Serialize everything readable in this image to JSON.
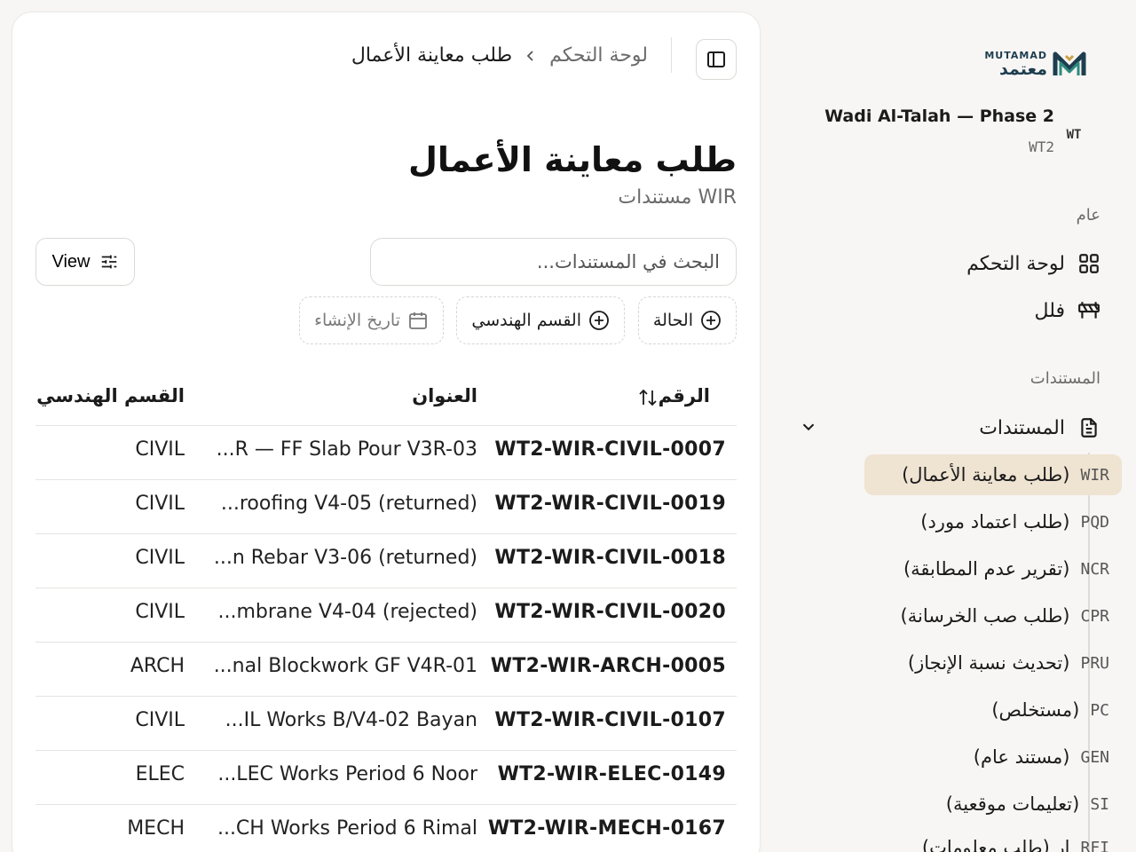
{
  "brand": {
    "name_en": "MUTAMAD",
    "name_ar": "معتمد",
    "colors": {
      "navy": "#1e3d4f",
      "teal": "#2f8a7e",
      "gold": "#c9a24a"
    }
  },
  "project": {
    "badge": "WT",
    "name": "Wadi Al-Talah — Phase 2",
    "code": "WT2"
  },
  "sidebar": {
    "section_general": "عام",
    "nav": [
      {
        "label": "لوحة التحكم",
        "icon": "dashboard-grid-icon"
      },
      {
        "label": "فلل",
        "icon": "barrier-icon"
      }
    ],
    "section_docs": "المستندات",
    "docs_group": {
      "label": "المستندات",
      "icon": "document-icon",
      "expanded": true
    },
    "doc_types": [
      {
        "code": "WIR",
        "label": "(طلب معاينة الأعمال)",
        "active": true
      },
      {
        "code": "PQD",
        "label": "(طلب اعتماد مورد)"
      },
      {
        "code": "NCR",
        "label": "(تقرير عدم المطابقة)"
      },
      {
        "code": "CPR",
        "label": "(طلب صب الخرسانة)"
      },
      {
        "code": "PRU",
        "label": "(تحديث نسبة الإنجاز)"
      },
      {
        "code": "PC",
        "label": "(مستخلص)"
      },
      {
        "code": "GEN",
        "label": "(مستند عام)"
      },
      {
        "code": "SI",
        "label": "(تعليمات موقعية)"
      },
      {
        "code": "RFI",
        "label": "(طلب معلومات) ار"
      }
    ]
  },
  "header": {
    "breadcrumb": {
      "parent": "لوحة التحكم",
      "current": "طلب معاينة الأعمال"
    }
  },
  "main": {
    "title": "طلب معاينة الأعمال",
    "subtitle": "مستندات WIR",
    "view_label": "View",
    "search_placeholder": "البحث في المستندات...",
    "filters": [
      {
        "label": "الحالة",
        "icon": "plus-circle-icon"
      },
      {
        "label": "القسم الهندسي",
        "icon": "plus-circle-icon"
      },
      {
        "label": "تاريخ الإنشاء",
        "icon": "calendar-icon"
      }
    ],
    "table": {
      "columns": {
        "number": "الرقم",
        "title": "العنوان",
        "discipline": "القسم الهندسي"
      },
      "rows": [
        {
          "number": "WT2-WIR-CIVIL-0007",
          "title": "...R — FF Slab Pour V3R-03",
          "discipline": "CIVIL"
        },
        {
          "number": "WT2-WIR-CIVIL-0019",
          "title": "...roofing V4-05 (returned)",
          "discipline": "CIVIL"
        },
        {
          "number": "WT2-WIR-CIVIL-0018",
          "title": "...n Rebar V3-06 (returned)",
          "discipline": "CIVIL"
        },
        {
          "number": "WT2-WIR-CIVIL-0020",
          "title": "...mbrane V4-04 (rejected)",
          "discipline": "CIVIL"
        },
        {
          "number": "WT2-WIR-ARCH-0005",
          "title": "...nal Blockwork GF V4R-01",
          "discipline": "ARCH"
        },
        {
          "number": "WT2-WIR-CIVIL-0107",
          "title": "...IL Works B/V4-02 Bayan",
          "discipline": "CIVIL"
        },
        {
          "number": "WT2-WIR-ELEC-0149",
          "title": "...LEC Works Period 6 Noor",
          "discipline": "ELEC"
        },
        {
          "number": "WT2-WIR-MECH-0167",
          "title": "...CH Works Period 6 Rimal",
          "discipline": "MECH"
        }
      ]
    }
  }
}
